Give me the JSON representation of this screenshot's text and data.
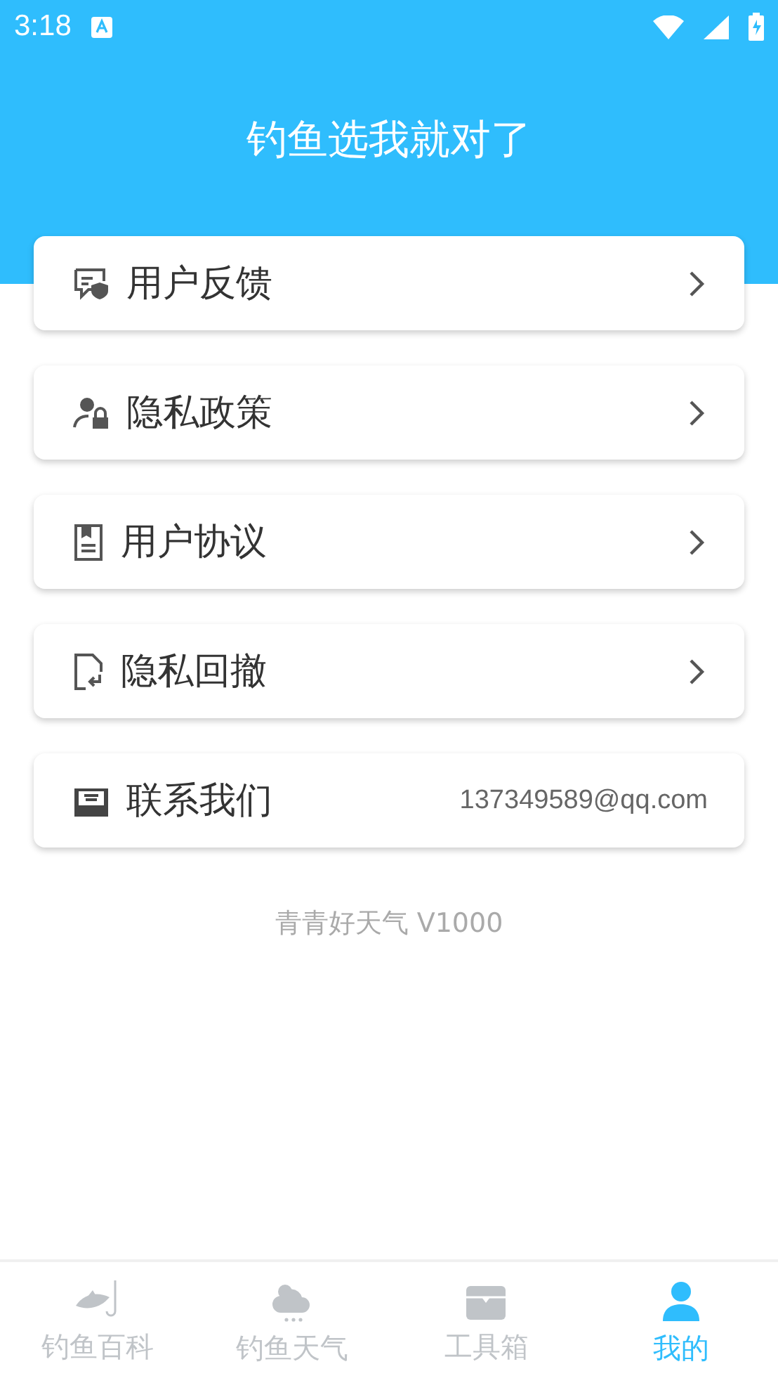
{
  "status_bar": {
    "time": "3:18"
  },
  "header": {
    "title": "钓鱼选我就对了"
  },
  "menu": [
    {
      "kind": "link",
      "label": "用户反馈"
    },
    {
      "kind": "link",
      "label": "隐私政策"
    },
    {
      "kind": "link",
      "label": "用户协议"
    },
    {
      "kind": "link",
      "label": "隐私回撤"
    },
    {
      "kind": "contact",
      "label": "联系我们",
      "value": "137349589@qq.com"
    }
  ],
  "version": "青青好天气 V1000",
  "bottom_nav": [
    {
      "label": "钓鱼百科",
      "selected": false
    },
    {
      "label": "钓鱼天气",
      "selected": false
    },
    {
      "label": "工具箱",
      "selected": false
    },
    {
      "label": "我的",
      "selected": true
    }
  ]
}
